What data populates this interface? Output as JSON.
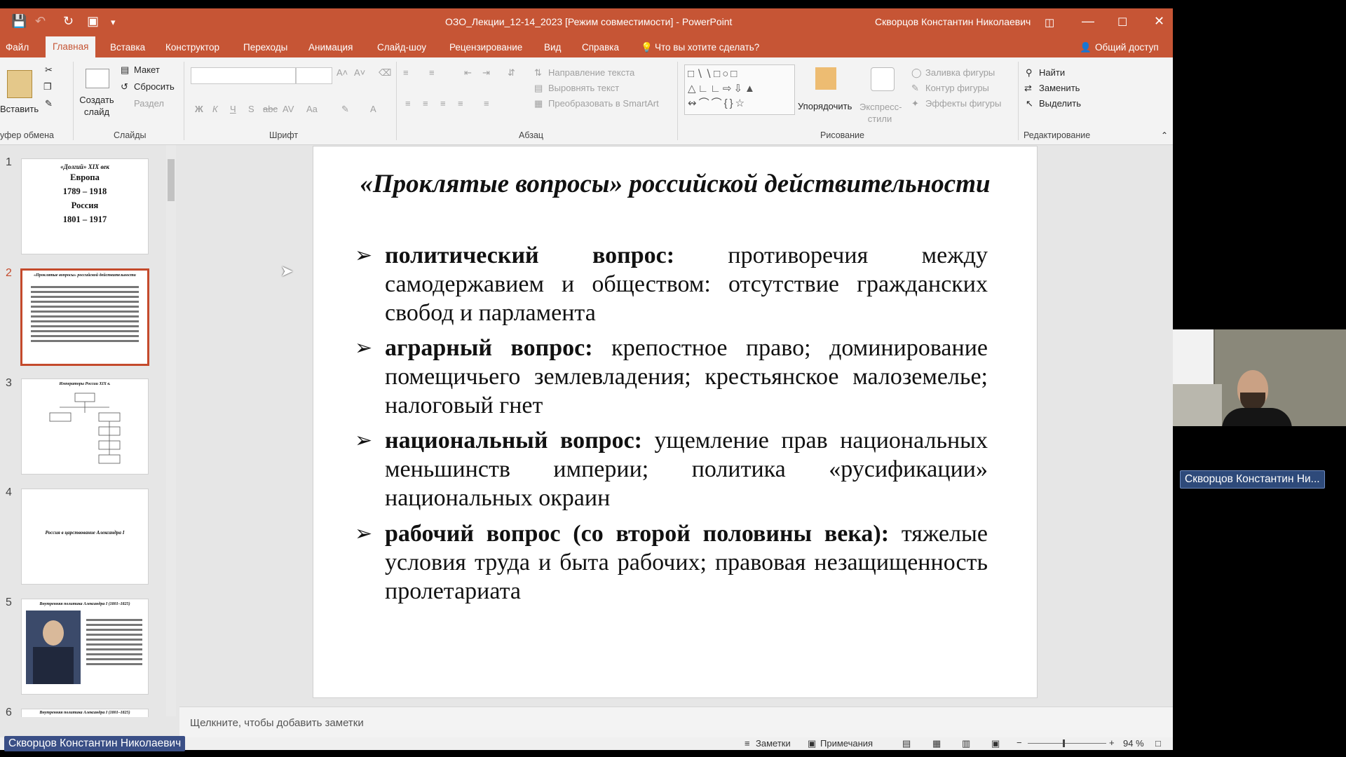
{
  "window": {
    "title": "ОЗО_Лекции_12-14_2023 [Режим совместимости] - PowerPoint",
    "user": "Скворцов Константин Николаевич"
  },
  "tabs": [
    "Файл",
    "Главная",
    "Вставка",
    "Конструктор",
    "Переходы",
    "Анимация",
    "Слайд-шоу",
    "Рецензирование",
    "Вид",
    "Справка"
  ],
  "tell_me": "Что вы хотите сделать?",
  "share": "Общий доступ",
  "ribbon": {
    "paste": "Вставить",
    "new_slide": "Создать слайд",
    "layout": "Макет",
    "reset": "Сбросить",
    "section": "Раздел",
    "shape_fill": "Заливка фигуры",
    "shape_outline": "Контур фигуры",
    "shape_effects": "Эффекты фигуры",
    "text_direction": "Направление текста",
    "align_text": "Выровнять текст",
    "smartart": "Преобразовать в SmartArt",
    "arrange": "Упорядочить",
    "quick_styles": "Экспресс-стили",
    "find": "Найти",
    "replace": "Заменить",
    "select": "Выделить",
    "groups": {
      "clipboard": "уфер обмена",
      "slides": "Слайды",
      "font": "Шрифт",
      "paragraph": "Абзац",
      "drawing": "Рисование",
      "editing": "Редактирование"
    }
  },
  "thumbnails": [
    {
      "num": "1",
      "lines": [
        "«Долгий» XIX век",
        "Европа",
        "1789 – 1918",
        "Россия",
        "1801 – 1917"
      ]
    },
    {
      "num": "2",
      "title": "«Проклятые вопросы» российской действительности"
    },
    {
      "num": "3",
      "title": "Императоры России XIX в."
    },
    {
      "num": "4",
      "title": "Россия в царствование Александра I"
    },
    {
      "num": "5",
      "title": "Внутренняя политика Александра I (1801–1825)"
    },
    {
      "num": "6",
      "title": "Внутренняя политика Александра I (1801–1825)"
    }
  ],
  "slide": {
    "title": "«Проклятые вопросы» российской действительности",
    "bullets": [
      {
        "bold": "политический вопрос:",
        "text": " противоречия между самодержавием и обществом: отсутствие гражданских свобод и парламента"
      },
      {
        "bold": "аграрный вопрос:",
        "text": " крепостное право; доминирование помещичьего землевладения; крестьянское малоземелье; налоговый гнет"
      },
      {
        "bold": "национальный вопрос:",
        "text": " ущемление прав национальных меньшинств империи; политика «русификации» национальных окраин"
      },
      {
        "bold": "рабочий вопрос (со второй половины века):",
        "text": " тяжелые условия труда и быта рабочих; правовая незащищенность пролетариата"
      }
    ],
    "bullet_mark": "➢"
  },
  "notes_placeholder": "Щелкните, чтобы добавить заметки",
  "status": {
    "notes": "Заметки",
    "comments": "Примечания",
    "zoom": "94 %"
  },
  "video": {
    "participant": "Скворцов Константин Ни...",
    "self": "Скворцов Константин Николаевич"
  },
  "colors": {
    "accent": "#c65535",
    "selected_thumb_border": "#c44a2c",
    "name_label": "#2e4a7a"
  }
}
